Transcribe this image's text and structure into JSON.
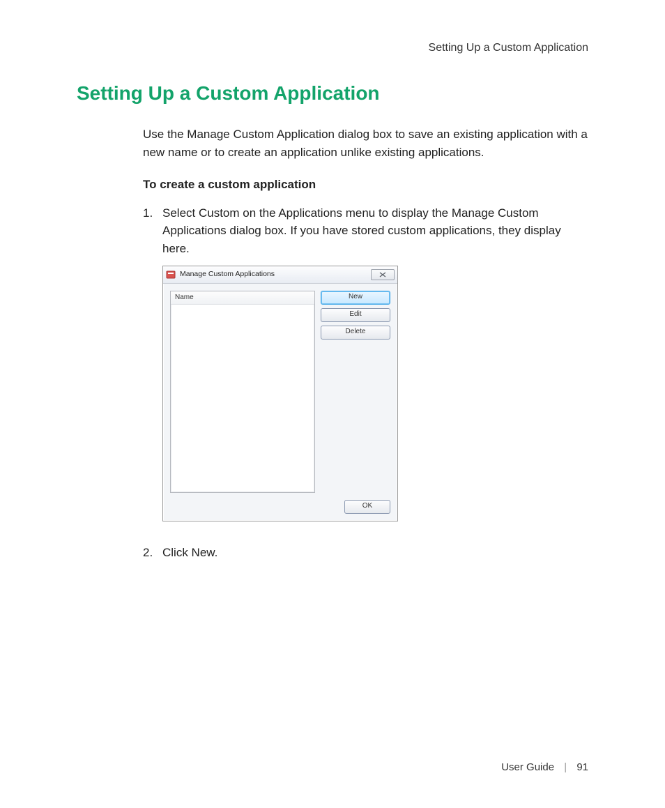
{
  "page": {
    "running_head": "Setting Up a Custom Application",
    "section_title": "Setting Up a Custom Application",
    "intro": "Use the Manage Custom Application dialog box to save an existing application with a new name or to create an application unlike existing applications.",
    "subhead": "To create a custom application",
    "steps": [
      {
        "num": "1.",
        "text": "Select Custom on the Applications menu to display the Manage Custom Applications dialog box. If you have stored custom applications, they display here."
      },
      {
        "num": "2.",
        "text": "Click New."
      }
    ],
    "footer_doc": "User Guide",
    "footer_sep": "|",
    "footer_page": "91"
  },
  "dialog": {
    "title": "Manage Custom Applications",
    "column_header": "Name",
    "buttons": {
      "new": "New",
      "edit": "Edit",
      "delete": "Delete",
      "ok": "OK"
    }
  }
}
